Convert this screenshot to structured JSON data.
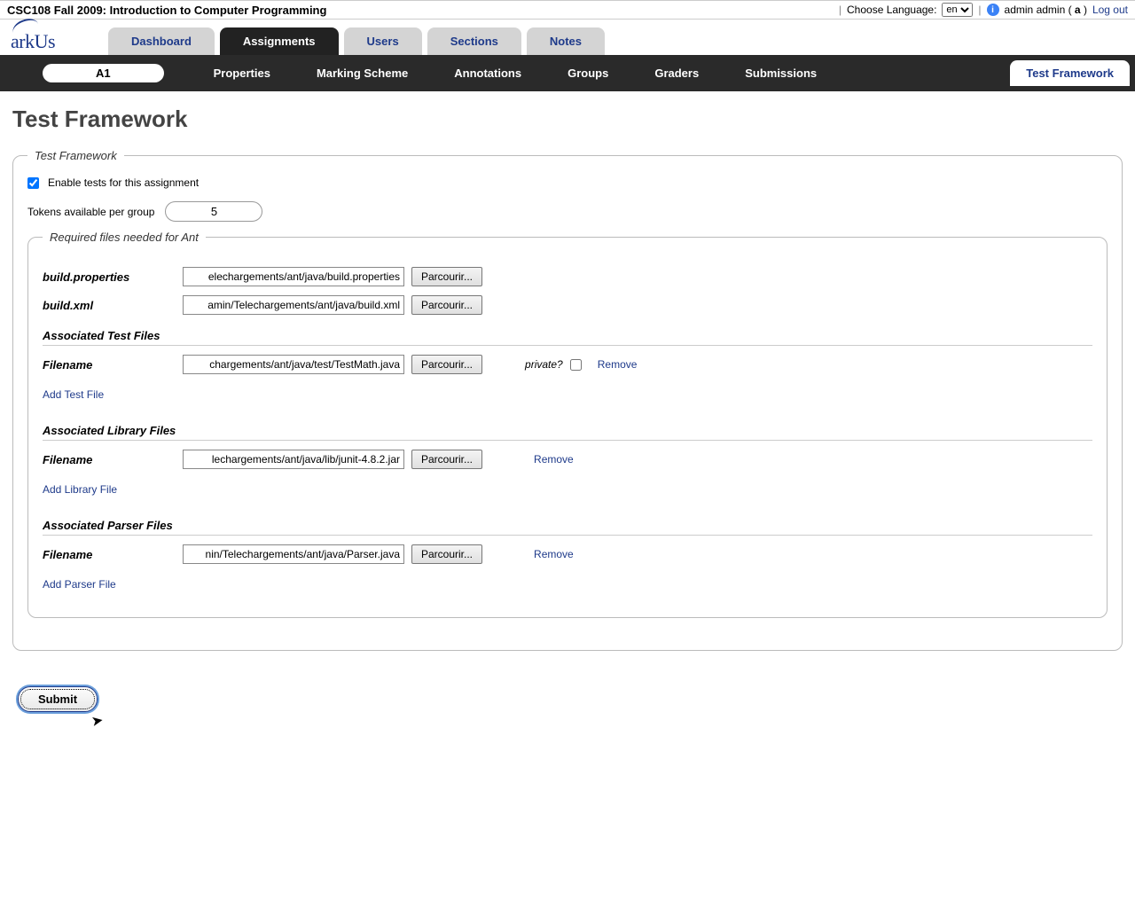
{
  "top": {
    "course_title": "CSC108 Fall 2009: Introduction to Computer Programming",
    "choose_lang": "Choose Language:",
    "lang_value": "en",
    "user_name": "admin admin",
    "user_short": "a",
    "logout": "Log out"
  },
  "logo_text": "arkUs",
  "main_tabs": [
    "Dashboard",
    "Assignments",
    "Users",
    "Sections",
    "Notes"
  ],
  "main_tab_active": 1,
  "assignment_badge": "A1",
  "sub_tabs": [
    "Properties",
    "Marking Scheme",
    "Annotations",
    "Groups",
    "Graders",
    "Submissions"
  ],
  "sub_tab_active": "Test Framework",
  "page_title": "Test Framework",
  "fieldset_legend": "Test Framework",
  "enable_label": "Enable tests for this assignment",
  "enable_checked": true,
  "tokens_label": "Tokens available per group",
  "tokens_value": "5",
  "req_legend": "Required files needed for Ant",
  "build_properties_label": "build.properties",
  "build_properties_value": "elechargements/ant/java/build.properties",
  "build_xml_label": "build.xml",
  "build_xml_value": "amin/Telechargements/ant/java/build.xml",
  "browse_label": "Parcourir...",
  "test_heading": "Associated Test Files",
  "filename_label": "Filename",
  "test_file_value": "chargements/ant/java/test/TestMath.java",
  "private_label": "private?",
  "remove_label": "Remove",
  "add_test": "Add Test File",
  "lib_heading": "Associated Library Files",
  "lib_file_value": "lechargements/ant/java/lib/junit-4.8.2.jar",
  "add_lib": "Add Library File",
  "parser_heading": "Associated Parser Files",
  "parser_file_value": "nin/Telechargements/ant/java/Parser.java",
  "add_parser": "Add Parser File",
  "submit_label": "Submit"
}
